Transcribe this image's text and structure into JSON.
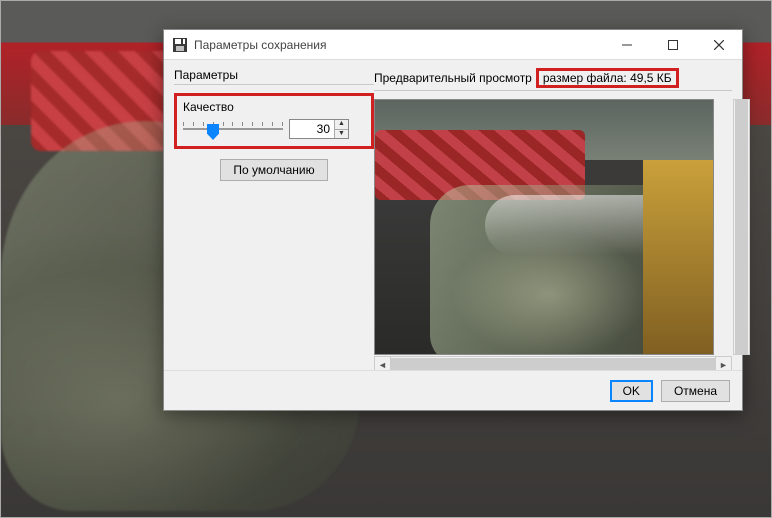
{
  "window": {
    "title": "Параметры сохранения"
  },
  "left": {
    "section_label": "Параметры",
    "quality_label": "Качество",
    "quality_value": "30",
    "slider_percent": 30,
    "default_button": "По умолчанию"
  },
  "right": {
    "preview_label": "Предварительный просмотр",
    "filesize_label": "размер файла: 49,5 КБ"
  },
  "footer": {
    "ok": "OK",
    "cancel": "Отмена"
  }
}
